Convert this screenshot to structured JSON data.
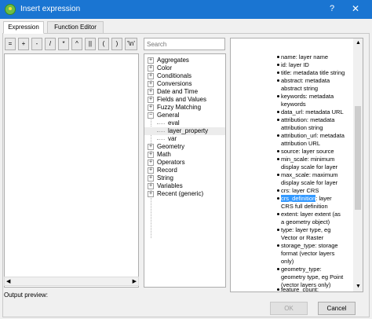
{
  "window": {
    "title": "Insert expression",
    "help_glyph": "?",
    "close_glyph": "✕"
  },
  "tabs": [
    {
      "label": "Expression",
      "active": true
    },
    {
      "label": "Function Editor",
      "active": false
    }
  ],
  "operators": [
    "=",
    "+",
    "-",
    "/",
    "*",
    "^",
    "||",
    "(",
    ")",
    "'\\n'"
  ],
  "search": {
    "placeholder": "Search"
  },
  "tree": [
    {
      "label": "Aggregates",
      "expander": "+"
    },
    {
      "label": "Color",
      "expander": "+"
    },
    {
      "label": "Conditionals",
      "expander": "+"
    },
    {
      "label": "Conversions",
      "expander": "+"
    },
    {
      "label": "Date and Time",
      "expander": "+"
    },
    {
      "label": "Fields and Values",
      "expander": "+"
    },
    {
      "label": "Fuzzy Matching",
      "expander": "+"
    },
    {
      "label": "General",
      "expander": "−"
    },
    {
      "label": "eval",
      "child": true
    },
    {
      "label": "layer_property",
      "child": true,
      "selected": true
    },
    {
      "label": "var",
      "child": true
    },
    {
      "label": "Geometry",
      "expander": "+"
    },
    {
      "label": "Math",
      "expander": "+"
    },
    {
      "label": "Operators",
      "expander": "+"
    },
    {
      "label": "Record",
      "expander": "+"
    },
    {
      "label": "String",
      "expander": "+"
    },
    {
      "label": "Variables",
      "expander": "+"
    },
    {
      "label": "Recent (generic)",
      "expander": "+"
    }
  ],
  "help": {
    "lines": [
      "name: layer name",
      "id: layer ID",
      "title: metadata title string",
      "abstract: metadata",
      "abstract string",
      "keywords: metadata",
      "keywords",
      "data_url: metadata URL",
      "attribution: metadata",
      "attribution string",
      "attribution_url: metadata",
      "attribution URL",
      "source: layer source",
      "min_scale: minimum",
      "display scale for layer",
      "max_scale: maximum",
      "display scale for layer",
      "crs: layer CRS",
      "crs_definition",
      "CRS full definition",
      "extent: layer extent (as",
      "a geometry object)",
      "type: layer type, eg",
      "Vector or Raster",
      "storage_type: storage",
      "format (vector layers",
      "only)",
      "geometry_type:",
      "geometry type, eg Point",
      "(vector layers only)",
      "feature_count:"
    ],
    "crs_definition_highlight": "crs_definition",
    "crs_definition_rest": ": layer"
  },
  "output_preview_label": "Output preview:",
  "buttons": {
    "ok": "OK",
    "cancel": "Cancel"
  },
  "scroll": {
    "left": "◀",
    "right": "▶",
    "up": "▲",
    "down": "▼"
  }
}
